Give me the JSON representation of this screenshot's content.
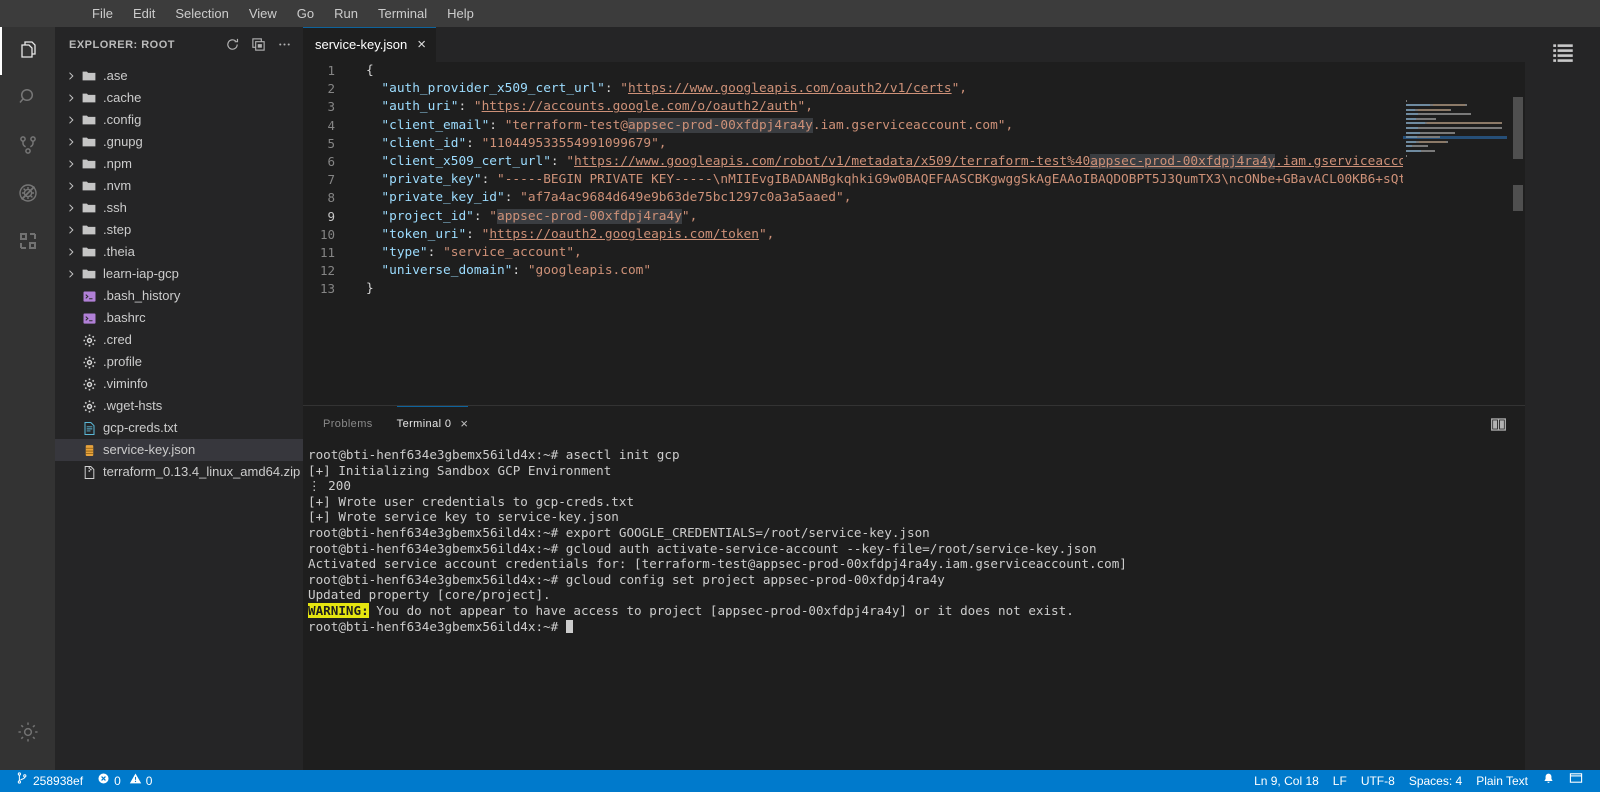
{
  "menubar": {
    "items": [
      "File",
      "Edit",
      "Selection",
      "View",
      "Go",
      "Run",
      "Terminal",
      "Help"
    ]
  },
  "activitybar": {
    "items": [
      {
        "name": "explorer",
        "icon": "files-icon",
        "active": true
      },
      {
        "name": "search",
        "icon": "search-icon",
        "active": false
      },
      {
        "name": "source-control",
        "icon": "source-control-icon",
        "active": false
      },
      {
        "name": "run-and-debug",
        "icon": "debug-disabled-icon",
        "active": false
      },
      {
        "name": "extensions",
        "icon": "extensions-icon",
        "active": false
      }
    ],
    "bottom": [
      {
        "name": "manage",
        "icon": "gear-icon"
      }
    ]
  },
  "sidebar": {
    "title": "EXPLORER: ROOT",
    "actions": [
      {
        "name": "refresh",
        "icon": "refresh-icon"
      },
      {
        "name": "collapse-all",
        "icon": "collapse-all-icon"
      },
      {
        "name": "more-actions",
        "icon": "ellipsis-icon"
      }
    ],
    "tree": [
      {
        "label": ".ase",
        "type": "folder",
        "icon": "folder-icon",
        "expanded": false,
        "selected": false
      },
      {
        "label": ".cache",
        "type": "folder",
        "icon": "folder-icon",
        "expanded": false,
        "selected": false
      },
      {
        "label": ".config",
        "type": "folder",
        "icon": "folder-icon",
        "expanded": false,
        "selected": false
      },
      {
        "label": ".gnupg",
        "type": "folder",
        "icon": "folder-icon",
        "expanded": false,
        "selected": false
      },
      {
        "label": ".npm",
        "type": "folder",
        "icon": "folder-icon",
        "expanded": false,
        "selected": false
      },
      {
        "label": ".nvm",
        "type": "folder",
        "icon": "folder-icon",
        "expanded": false,
        "selected": false
      },
      {
        "label": ".ssh",
        "type": "folder",
        "icon": "folder-icon",
        "expanded": false,
        "selected": false
      },
      {
        "label": ".step",
        "type": "folder",
        "icon": "folder-icon",
        "expanded": false,
        "selected": false
      },
      {
        "label": ".theia",
        "type": "folder",
        "icon": "folder-icon",
        "expanded": false,
        "selected": false
      },
      {
        "label": "learn-iap-gcp",
        "type": "folder",
        "icon": "folder-icon",
        "expanded": false,
        "selected": false
      },
      {
        "label": ".bash_history",
        "type": "file",
        "icon": "terminal-file-icon",
        "selected": false
      },
      {
        "label": ".bashrc",
        "type": "file",
        "icon": "terminal-file-icon",
        "selected": false
      },
      {
        "label": ".cred",
        "type": "file",
        "icon": "gear-file-icon",
        "selected": false
      },
      {
        "label": ".profile",
        "type": "file",
        "icon": "gear-file-icon",
        "selected": false
      },
      {
        "label": ".viminfo",
        "type": "file",
        "icon": "gear-file-icon",
        "selected": false
      },
      {
        "label": ".wget-hsts",
        "type": "file",
        "icon": "gear-file-icon",
        "selected": false
      },
      {
        "label": "gcp-creds.txt",
        "type": "file",
        "icon": "text-file-icon",
        "selected": false
      },
      {
        "label": "service-key.json",
        "type": "file",
        "icon": "json-file-icon",
        "selected": true
      },
      {
        "label": "terraform_0.13.4_linux_amd64.zip",
        "type": "file",
        "icon": "zip-file-icon",
        "selected": false
      }
    ]
  },
  "editor": {
    "tabs": [
      {
        "label": "service-key.json",
        "active": true,
        "close": "×"
      }
    ],
    "lines": [
      {
        "num": "1",
        "tokens": [
          {
            "t": "{",
            "c": "brace"
          }
        ]
      },
      {
        "num": "2",
        "tokens": [
          {
            "t": "  \"auth_provider_x509_cert_url\"",
            "c": "key"
          },
          {
            "t": ": ",
            "c": "pun"
          },
          {
            "t": "\"",
            "c": "str"
          },
          {
            "t": "https://www.googleapis.com/oauth2/v1/certs",
            "c": "link"
          },
          {
            "t": "\",",
            "c": "str"
          }
        ]
      },
      {
        "num": "3",
        "tokens": [
          {
            "t": "  \"auth_uri\"",
            "c": "key"
          },
          {
            "t": ": ",
            "c": "pun"
          },
          {
            "t": "\"",
            "c": "str"
          },
          {
            "t": "https://accounts.google.com/o/oauth2/auth",
            "c": "link"
          },
          {
            "t": "\",",
            "c": "str"
          }
        ]
      },
      {
        "num": "4",
        "tokens": [
          {
            "t": "  \"client_email\"",
            "c": "key"
          },
          {
            "t": ": ",
            "c": "pun"
          },
          {
            "t": "\"terraform-test@",
            "c": "str"
          },
          {
            "t": "appsec-prod-00xfdpj4ra4y",
            "c": "strsel"
          },
          {
            "t": ".iam.gserviceaccount.com\",",
            "c": "str"
          }
        ]
      },
      {
        "num": "5",
        "tokens": [
          {
            "t": "  \"client_id\"",
            "c": "key"
          },
          {
            "t": ": ",
            "c": "pun"
          },
          {
            "t": "\"110449533554991099679\",",
            "c": "str"
          }
        ]
      },
      {
        "num": "6",
        "tokens": [
          {
            "t": "  \"client_x509_cert_url\"",
            "c": "key"
          },
          {
            "t": ": ",
            "c": "pun"
          },
          {
            "t": "\"",
            "c": "str"
          },
          {
            "t": "https://www.googleapis.com/robot/v1/metadata/x509/terraform-test%40",
            "c": "link"
          },
          {
            "t": "appsec-prod-00xfdpj4ra4y",
            "c": "linksel"
          },
          {
            "t": ".iam.gserviceaccount.com",
            "c": "link"
          }
        ]
      },
      {
        "num": "7",
        "tokens": [
          {
            "t": "  \"private_key\"",
            "c": "key"
          },
          {
            "t": ": ",
            "c": "pun"
          },
          {
            "t": "\"-----BEGIN PRIVATE KEY-----\\nMIIEvgIBADANBgkqhkiG9w0BAQEFAASCBKgwggSkAgEAAoIBAQDOBPT5J3QumTX3\\ncONbe+GBavACL00KB6+sQtUoknEj",
            "c": "str"
          }
        ]
      },
      {
        "num": "8",
        "tokens": [
          {
            "t": "  \"private_key_id\"",
            "c": "key"
          },
          {
            "t": ": ",
            "c": "pun"
          },
          {
            "t": "\"af7a4ac9684d649e9b63de75bc1297c0a3a5aaed\",",
            "c": "str"
          }
        ]
      },
      {
        "num": "9",
        "current": true,
        "tokens": [
          {
            "t": "  \"project_id\"",
            "c": "key"
          },
          {
            "t": ": ",
            "c": "pun"
          },
          {
            "t": "\"",
            "c": "str"
          },
          {
            "t": "appsec-prod-00xfdpj4ra4y",
            "c": "strsel"
          },
          {
            "t": "\",",
            "c": "str"
          }
        ]
      },
      {
        "num": "10",
        "tokens": [
          {
            "t": "  \"token_uri\"",
            "c": "key"
          },
          {
            "t": ": ",
            "c": "pun"
          },
          {
            "t": "\"",
            "c": "str"
          },
          {
            "t": "https://oauth2.googleapis.com/token",
            "c": "link"
          },
          {
            "t": "\",",
            "c": "str"
          }
        ]
      },
      {
        "num": "11",
        "tokens": [
          {
            "t": "  \"type\"",
            "c": "key"
          },
          {
            "t": ": ",
            "c": "pun"
          },
          {
            "t": "\"service_account\",",
            "c": "str"
          }
        ]
      },
      {
        "num": "12",
        "tokens": [
          {
            "t": "  \"universe_domain\"",
            "c": "key"
          },
          {
            "t": ": ",
            "c": "pun"
          },
          {
            "t": "\"googleapis.com\"",
            "c": "str"
          }
        ]
      },
      {
        "num": "13",
        "tokens": [
          {
            "t": "}",
            "c": "brace"
          }
        ]
      }
    ]
  },
  "panel": {
    "tabs": [
      {
        "label": "Problems",
        "active": false
      },
      {
        "label": "Terminal 0",
        "active": true,
        "close": "×"
      }
    ],
    "actions": [
      {
        "name": "split-terminal",
        "icon": "split-icon"
      }
    ],
    "terminal": {
      "lines": [
        {
          "segments": [
            {
              "t": "root@bti-henf634e3gbemx56ild4x:~# asectl init gcp"
            }
          ]
        },
        {
          "segments": [
            {
              "t": "[+] Initializing Sandbox GCP Environment"
            }
          ]
        },
        {
          "segments": [
            {
              "t": "⋮ 200"
            }
          ]
        },
        {
          "segments": [
            {
              "t": "[+] Wrote user credentials to gcp-creds.txt"
            }
          ]
        },
        {
          "segments": [
            {
              "t": "[+] Wrote service key to service-key.json"
            }
          ]
        },
        {
          "segments": [
            {
              "t": "root@bti-henf634e3gbemx56ild4x:~# export GOOGLE_CREDENTIALS=/root/service-key.json"
            }
          ]
        },
        {
          "segments": [
            {
              "t": "root@bti-henf634e3gbemx56ild4x:~# gcloud auth activate-service-account --key-file=/root/service-key.json"
            }
          ]
        },
        {
          "segments": [
            {
              "t": "Activated service account credentials for: [terraform-test@appsec-prod-00xfdpj4ra4y.iam.gserviceaccount.com]"
            }
          ]
        },
        {
          "segments": [
            {
              "t": "root@bti-henf634e3gbemx56ild4x:~# gcloud config set project appsec-prod-00xfdpj4ra4y"
            }
          ]
        },
        {
          "segments": [
            {
              "t": "Updated property [core/project]."
            }
          ]
        },
        {
          "segments": [
            {
              "t": "WARNING:",
              "style": "warn"
            },
            {
              "t": " You do not appear to have access to project [appsec-prod-00xfdpj4ra4y] or it does not exist."
            }
          ]
        },
        {
          "segments": [
            {
              "t": "root@bti-henf634e3gbemx56ild4x:~# "
            },
            {
              "t": "",
              "style": "cursor"
            }
          ]
        }
      ]
    }
  },
  "right_strip": {
    "icons": [
      {
        "name": "outline-list-icon"
      }
    ]
  },
  "statusbar": {
    "left": [
      {
        "name": "branch",
        "icon": "branch-icon",
        "label": "258938ef"
      },
      {
        "name": "errors",
        "icon": "error-icon",
        "label": "0",
        "icon2": "warning-icon",
        "label2": "0"
      }
    ],
    "right": [
      {
        "name": "cursor-position",
        "label": "Ln 9, Col 18"
      },
      {
        "name": "line-endings",
        "label": "LF"
      },
      {
        "name": "encoding",
        "label": "UTF-8"
      },
      {
        "name": "indentation",
        "label": "Spaces: 4"
      },
      {
        "name": "language-mode",
        "label": "Plain Text"
      },
      {
        "name": "notifications",
        "icon": "bell-icon",
        "label": ""
      },
      {
        "name": "layout",
        "icon": "layout-icon",
        "label": ""
      }
    ]
  },
  "colors": {
    "accent": "#007acc",
    "tab_active_border": "#0e639c",
    "warning_bg": "#e5e510",
    "editor_bg": "#1e1e1e",
    "sidebar_bg": "#252526",
    "activitybar_bg": "#333333",
    "menubar_bg": "#3c3c3c",
    "json_key": "#9cdcfe",
    "json_string": "#ce9178",
    "selection_match": "#3a3d41"
  }
}
